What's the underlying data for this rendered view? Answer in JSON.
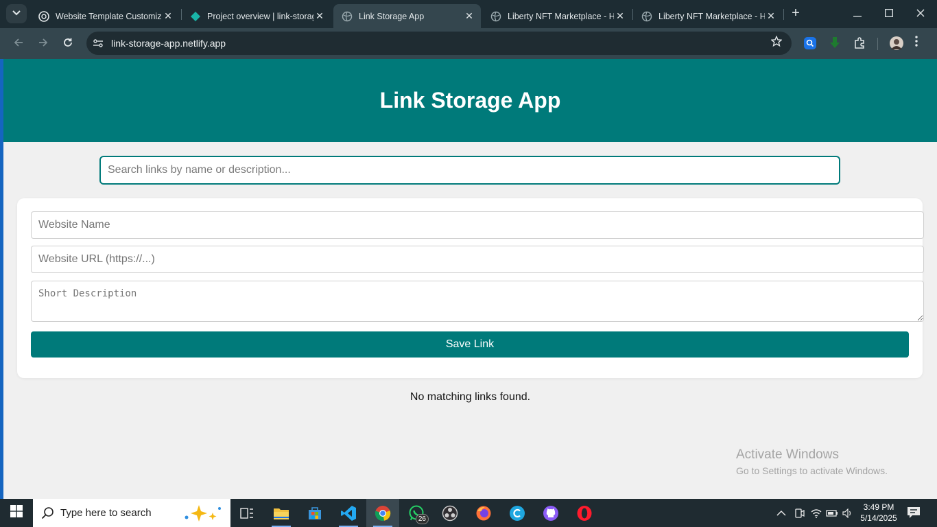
{
  "browser": {
    "tabs": [
      {
        "title": "Website Template Customiza",
        "icon": "openai-icon",
        "active": false
      },
      {
        "title": "Project overview | link-storag",
        "icon": "netlify-icon",
        "active": false
      },
      {
        "title": "Link Storage App",
        "icon": "globe-icon",
        "active": true
      },
      {
        "title": "Liberty NFT Marketplace - H",
        "icon": "globe-icon",
        "active": false
      },
      {
        "title": "Liberty NFT Marketplace - H",
        "icon": "globe-icon",
        "active": false
      }
    ],
    "close_glyph": "✕",
    "new_tab_glyph": "+",
    "url": "link-storage-app.netlify.app"
  },
  "app": {
    "title": "Link Storage App",
    "search_placeholder": "Search links by name or description...",
    "form": {
      "name_placeholder": "Website Name",
      "url_placeholder": "Website URL (https://...)",
      "description_placeholder": "Short Description",
      "save_label": "Save Link"
    },
    "empty_message": "No matching links found.",
    "accent_color": "#007a7a"
  },
  "watermark": {
    "line1": "Activate Windows",
    "line2": "Go to Settings to activate Windows."
  },
  "taskbar": {
    "search_text": "Type here to search",
    "whatsapp_badge": "26",
    "time": "3:49 PM",
    "date": "5/14/2025",
    "apps": [
      "task-view-icon",
      "file-explorer-icon",
      "microsoft-store-icon",
      "vscode-icon",
      "chrome-icon",
      "whatsapp-icon",
      "obs-icon",
      "firefox-icon",
      "canva-icon",
      "github-icon",
      "opera-icon"
    ]
  }
}
